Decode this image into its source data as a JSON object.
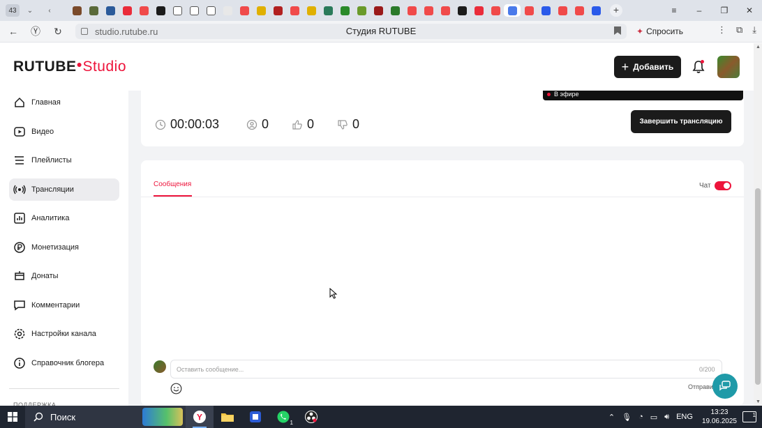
{
  "browser": {
    "tab_count": "43",
    "url": "studio.rutube.ru",
    "page_title": "Студия RUTUBE",
    "ask_label": "Спросить",
    "tab_icon_colors": [
      "#7a4a2a",
      "#5a6a3a",
      "#2a5a9a",
      "#ea2c3a",
      "#f04a4a",
      "#1b1b1b",
      "#ffffff",
      "#ffffff",
      "#ffffff",
      "#e8e8e8",
      "#f04a4a",
      "#e0b000",
      "#b22020",
      "#f04a4a",
      "#e0b000",
      "#2a7a5a",
      "#2a8a2a",
      "#6a9a2a",
      "#9a1a1a",
      "#2a7a2a",
      "#f04a4a",
      "#f04a4a",
      "#f04a4a",
      "#1b1b1b",
      "#ea2c3a",
      "#f04a4a",
      "#4a7aea",
      "#f04a4a",
      "#2a5aea",
      "#f04a4a",
      "#f04a4a",
      "#2a5aea"
    ]
  },
  "header": {
    "logo_rutube": "RUTUBE",
    "logo_studio": "Studio",
    "add_label": "Добавить"
  },
  "sidebar": {
    "items": [
      {
        "label": "Главная",
        "icon": "home-icon"
      },
      {
        "label": "Видео",
        "icon": "video-icon"
      },
      {
        "label": "Плейлисты",
        "icon": "playlist-icon"
      },
      {
        "label": "Трансляции",
        "icon": "broadcast-icon",
        "active": true
      },
      {
        "label": "Аналитика",
        "icon": "analytics-icon"
      },
      {
        "label": "Монетизация",
        "icon": "ruble-icon"
      },
      {
        "label": "Донаты",
        "icon": "donate-icon"
      },
      {
        "label": "Комментарии",
        "icon": "comment-icon"
      },
      {
        "label": "Настройки канала",
        "icon": "gear-icon"
      },
      {
        "label": "Справочник блогера",
        "icon": "info-icon"
      }
    ],
    "support_label": "ПОДДЕРЖКА"
  },
  "stream": {
    "live_badge": "В эфире",
    "duration": "00:00:03",
    "viewers": "0",
    "likes": "0",
    "dislikes": "0",
    "end_button": "Завершить трансляцию"
  },
  "chat": {
    "tab_label": "Сообщения",
    "toggle_label": "Чат",
    "toggle_on": true,
    "input_placeholder": "Оставить сообщение...",
    "char_count": "0/200",
    "send_label": "Отправить"
  },
  "taskbar": {
    "search_label": "Поиск",
    "lang": "ENG",
    "time": "13:23",
    "date": "19.06.2025",
    "notification_count": "1",
    "whatsapp_badge": "1"
  },
  "colors": {
    "brand_red": "#ed143b",
    "dark": "#1b1b1b",
    "help_teal": "#1f9aa8"
  }
}
